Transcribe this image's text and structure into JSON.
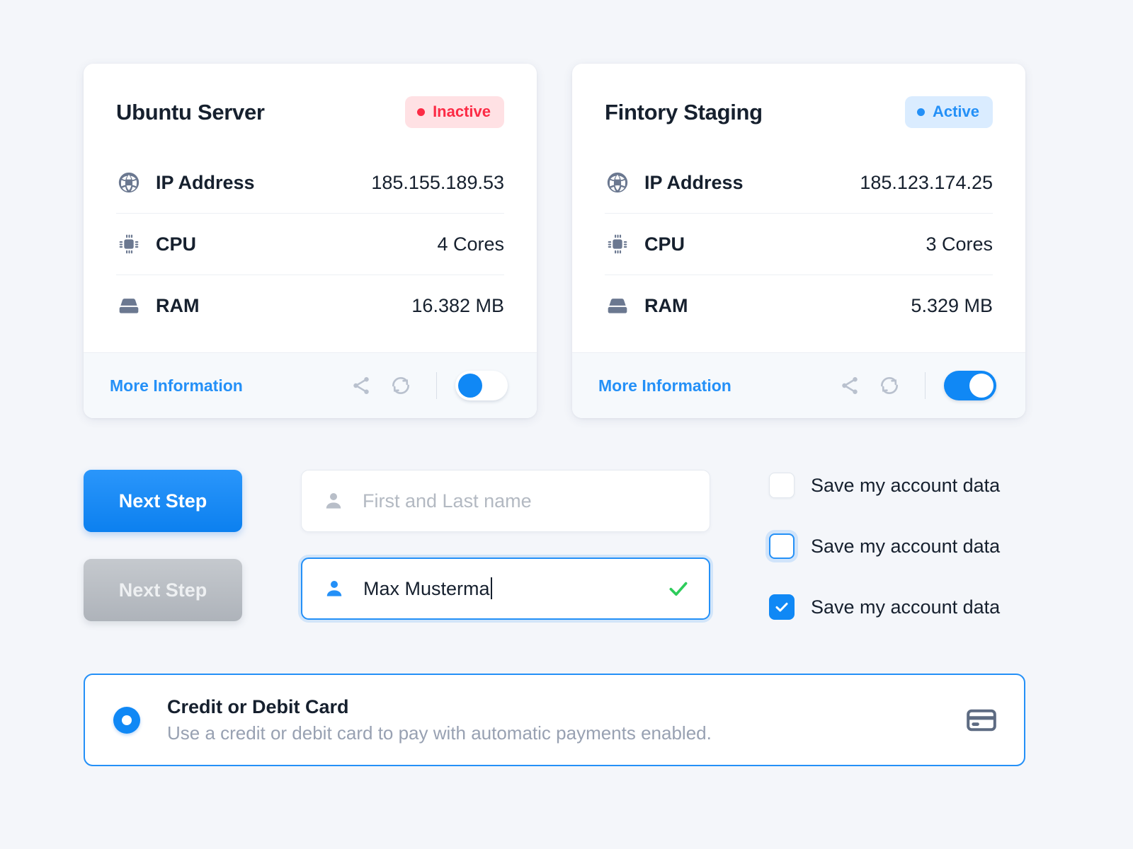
{
  "theme": {
    "background": "#f4f6fa",
    "accent": "#1088f5",
    "active_color": "#2490f7",
    "inactive_color": "#fc2b45",
    "success_color": "#2ecc5b",
    "text_color": "#16202e",
    "muted_color": "#98a1b2"
  },
  "servers": [
    {
      "title": "Ubuntu Server",
      "status_label": "Inactive",
      "status_state": "inactive",
      "specs": [
        {
          "icon": "globe-icon",
          "label": "IP Address",
          "value": "185.155.189.53"
        },
        {
          "icon": "cpu-icon",
          "label": "CPU",
          "value": "4 Cores"
        },
        {
          "icon": "ram-icon",
          "label": "RAM",
          "value": "16.382 MB"
        }
      ],
      "footer": {
        "more_label": "More Information",
        "share_icon": "share-icon",
        "refresh_icon": "refresh-icon",
        "toggle_state": "off"
      }
    },
    {
      "title": "Fintory Staging",
      "status_label": "Active",
      "status_state": "active",
      "specs": [
        {
          "icon": "globe-icon",
          "label": "IP Address",
          "value": "185.123.174.25"
        },
        {
          "icon": "cpu-icon",
          "label": "CPU",
          "value": "3 Cores"
        },
        {
          "icon": "ram-icon",
          "label": "RAM",
          "value": "5.329 MB"
        }
      ],
      "footer": {
        "more_label": "More Information",
        "share_icon": "share-icon",
        "refresh_icon": "refresh-icon",
        "toggle_state": "on"
      }
    }
  ],
  "buttons": {
    "primary_label": "Next Step",
    "disabled_label": "Next Step"
  },
  "inputs": {
    "empty": {
      "placeholder": "First and Last name",
      "icon": "user-icon"
    },
    "filled": {
      "value": "Max Musterma",
      "icon": "user-icon",
      "valid_icon": "check-icon"
    }
  },
  "checkboxes": [
    {
      "label": "Save my account data",
      "state": "unchecked"
    },
    {
      "label": "Save my account data",
      "state": "focused"
    },
    {
      "label": "Save my account data",
      "state": "checked"
    }
  ],
  "payment": {
    "title": "Credit or Debit Card",
    "description": "Use a credit or debit card to pay with automatic payments enabled.",
    "selected": true,
    "icon": "credit-card-icon"
  }
}
